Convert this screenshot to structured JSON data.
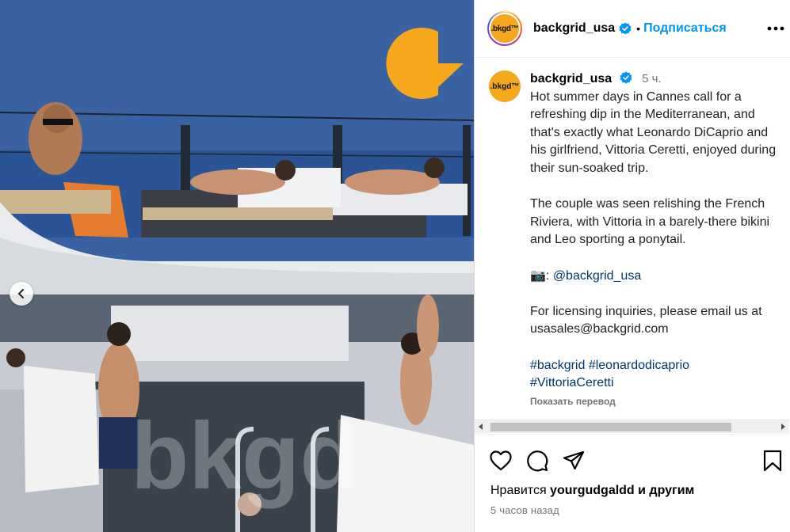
{
  "post": {
    "author": "backgrid_usa",
    "avatar_text": ".bkgd™",
    "follow_label": "Подписаться",
    "dot": "•"
  },
  "caption": {
    "author": "backgrid_usa",
    "time": "5 ч.",
    "para1": "Hot summer days in Cannes call for a refreshing dip in the Mediterranean, and that's exactly what Leonardo DiCaprio and his girlfriend, Vittoria Ceretti, enjoyed during their sun-soaked trip.",
    "para2": "The couple was seen relishing the French Riviera, with Vittoria in a barely-there bikini and Leo sporting a ponytail.",
    "camera_emoji": "📷",
    "credit_prefix": ": ",
    "credit_handle": "@backgrid_usa",
    "licensing": "For licensing inquiries, please email us at usasales@backgrid.com",
    "hashtags": [
      "#backgrid",
      "#leonardodicaprio",
      "#VittoriaCeretti"
    ],
    "translate_label": "Показать перевод"
  },
  "footer": {
    "likes_prefix": "Нравится ",
    "likes_user": "yourgudgaldd",
    "likes_suffix": " и другим",
    "posted_ago": "5 часов назад"
  },
  "watermark": {
    "text": "bkgd"
  },
  "colors": {
    "accent_blue": "#0095f6",
    "link_blue": "#00376b",
    "brand_orange": "#f5a81b",
    "muted_gray": "#737373"
  },
  "icons": [
    "chevron-left-icon",
    "verified-badge-icon",
    "more-options-icon",
    "heart-icon",
    "comment-icon",
    "share-icon",
    "bookmark-icon",
    "camera-emoji-icon"
  ]
}
